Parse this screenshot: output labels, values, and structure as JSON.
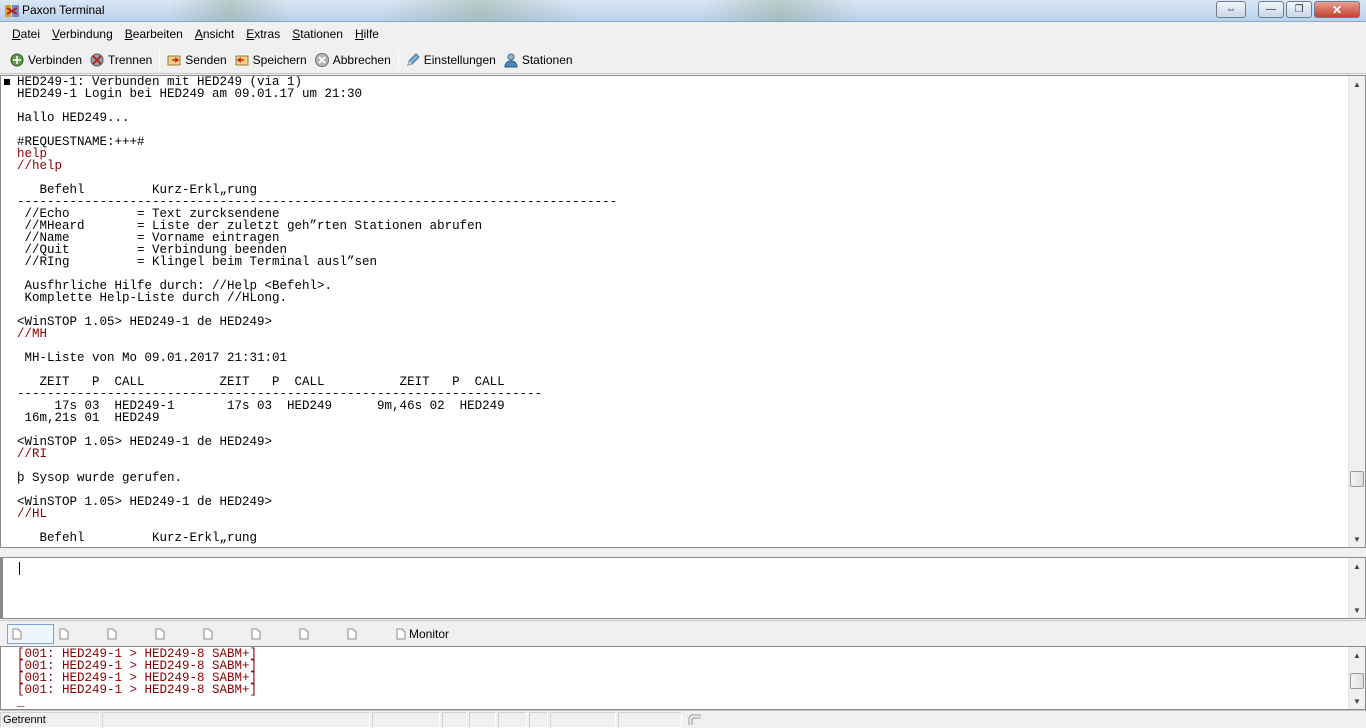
{
  "window": {
    "title": "Paxon Terminal",
    "controls": [
      "restore-arrows",
      "minimize",
      "maximize",
      "close"
    ]
  },
  "menu": [
    "Datei",
    "Verbindung",
    "Bearbeiten",
    "Ansicht",
    "Extras",
    "Stationen",
    "Hilfe"
  ],
  "toolbar": {
    "connect": "Verbinden",
    "disconnect": "Trennen",
    "send": "Senden",
    "save": "Speichern",
    "abort": "Abbrechen",
    "settings": "Einstellungen",
    "stations": "Stationen"
  },
  "terminal": {
    "lines": [
      {
        "text": "HED249-1: Verbunden mit HED249 (via 1)",
        "color": "#000000"
      },
      {
        "text": "HED249-1 Login bei HED249 am 09.01.17 um 21:30",
        "color": "#000000"
      },
      {
        "text": "",
        "color": "#000000"
      },
      {
        "text": "Hallo HED249...",
        "color": "#000000"
      },
      {
        "text": "",
        "color": "#000000"
      },
      {
        "text": "#REQUESTNAME:+++#",
        "color": "#000000"
      },
      {
        "text": "help",
        "color": "#8b0000"
      },
      {
        "text": "//help",
        "color": "#8b0000"
      },
      {
        "text": "",
        "color": "#000000"
      },
      {
        "text": "   Befehl         Kurz-Erkl„rung",
        "color": "#000000"
      },
      {
        "text": "--------------------------------------------------------------------------------",
        "color": "#000000"
      },
      {
        "text": " //Echo         = Text zurcksendene",
        "color": "#000000"
      },
      {
        "text": " //MHeard       = Liste der zuletzt geh”rten Stationen abrufen",
        "color": "#000000"
      },
      {
        "text": " //Name         = Vorname eintragen",
        "color": "#000000"
      },
      {
        "text": " //Quit         = Verbindung beenden",
        "color": "#000000"
      },
      {
        "text": " //RIng         = Klingel beim Terminal ausl”sen",
        "color": "#000000"
      },
      {
        "text": "",
        "color": "#000000"
      },
      {
        "text": " Ausfhrliche Hilfe durch: //Help <Befehl>.",
        "color": "#000000"
      },
      {
        "text": " Komplette Help-Liste durch //HLong.",
        "color": "#000000"
      },
      {
        "text": "",
        "color": "#000000"
      },
      {
        "text": "<WinSTOP 1.05> HED249-1 de HED249>",
        "color": "#000000"
      },
      {
        "text": "//MH",
        "color": "#8b0000"
      },
      {
        "text": "",
        "color": "#000000"
      },
      {
        "text": " MH-Liste von Mo 09.01.2017 21:31:01",
        "color": "#000000"
      },
      {
        "text": "",
        "color": "#000000"
      },
      {
        "text": "   ZEIT   P  CALL          ZEIT   P  CALL          ZEIT   P  CALL",
        "color": "#000000"
      },
      {
        "text": "----------------------------------------------------------------------",
        "color": "#000000"
      },
      {
        "text": "     17s 03  HED249-1       17s 03  HED249      9m,46s 02  HED249",
        "color": "#000000"
      },
      {
        "text": " 16m,21s 01  HED249",
        "color": "#000000"
      },
      {
        "text": "",
        "color": "#000000"
      },
      {
        "text": "<WinSTOP 1.05> HED249-1 de HED249>",
        "color": "#000000"
      },
      {
        "text": "//RI",
        "color": "#8b0000"
      },
      {
        "text": "",
        "color": "#000000"
      },
      {
        "text": "þ Sysop wurde gerufen.",
        "color": "#000000"
      },
      {
        "text": "",
        "color": "#000000"
      },
      {
        "text": "<WinSTOP 1.05> HED249-1 de HED249>",
        "color": "#000000"
      },
      {
        "text": "//HL",
        "color": "#8b0000"
      },
      {
        "text": "",
        "color": "#000000"
      },
      {
        "text": "   Befehl         Kurz-Erkl„rung",
        "color": "#000000"
      },
      {
        "text": "--------------------------------------------------------------------------------",
        "color": "#000000"
      }
    ]
  },
  "tabs": {
    "monitor_label": "Monitor"
  },
  "monitor": {
    "lines": [
      "[001: HED249-1 > HED249-8 SABM+]",
      "[001: HED249-1 > HED249-8 SABM+]",
      "[001: HED249-1 > HED249-8 SABM+]",
      "[001: HED249-1 > HED249-8 SABM+]",
      "_"
    ]
  },
  "status": {
    "connection": "Getrennt"
  },
  "colors": {
    "command_text": "#8b0000",
    "terminal_bg": "#ffffff",
    "chrome": "#f0f0f0"
  }
}
